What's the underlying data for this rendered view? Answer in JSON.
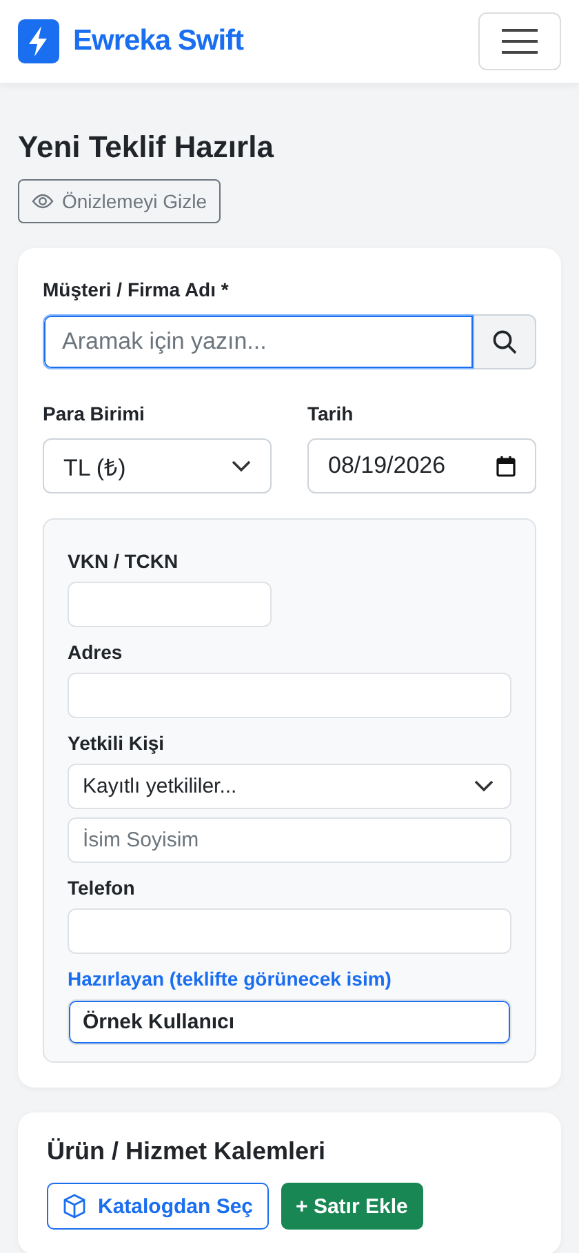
{
  "header": {
    "brand": "Ewreka Swift"
  },
  "page": {
    "title": "Yeni Teklif Hazırla",
    "preview_button": "Önizlemeyi Gizle"
  },
  "customer": {
    "label": "Müşteri / Firma Adı *",
    "search": {
      "placeholder": "Aramak için yazın...",
      "focused": true
    },
    "currency": {
      "label": "Para Birimi",
      "value": "TL (₺)"
    },
    "date": {
      "label": "Tarih",
      "value": "08/19/2026"
    },
    "details": [
      {
        "kind": "label",
        "text": "VKN / TCKN",
        "accent": false
      },
      {
        "kind": "short-input",
        "focused": false
      },
      {
        "kind": "label",
        "text": "Adres",
        "accent": false
      },
      {
        "kind": "input",
        "focused": false
      },
      {
        "kind": "label",
        "text": "Yetkili Kişi",
        "accent": false
      },
      {
        "kind": "select",
        "value": "Kayıtlı yetkililer..."
      },
      {
        "kind": "input",
        "placeholder": "İsim Soyisim",
        "focused": false
      },
      {
        "kind": "label",
        "text": "Telefon",
        "accent": false
      },
      {
        "kind": "input",
        "focused": false
      },
      {
        "kind": "label",
        "text": "Hazırlayan (teklifte görünecek isim)",
        "accent": true
      },
      {
        "kind": "input",
        "value": "Örnek Kullanıcı",
        "focused": true
      }
    ]
  },
  "items": {
    "title": "Ürün / Hizmet Kalemleri",
    "buttons": [
      {
        "kind": "outline",
        "label": "Katalogdan Seç"
      },
      {
        "kind": "solid",
        "label": "+ Satır Ekle"
      }
    ]
  }
}
